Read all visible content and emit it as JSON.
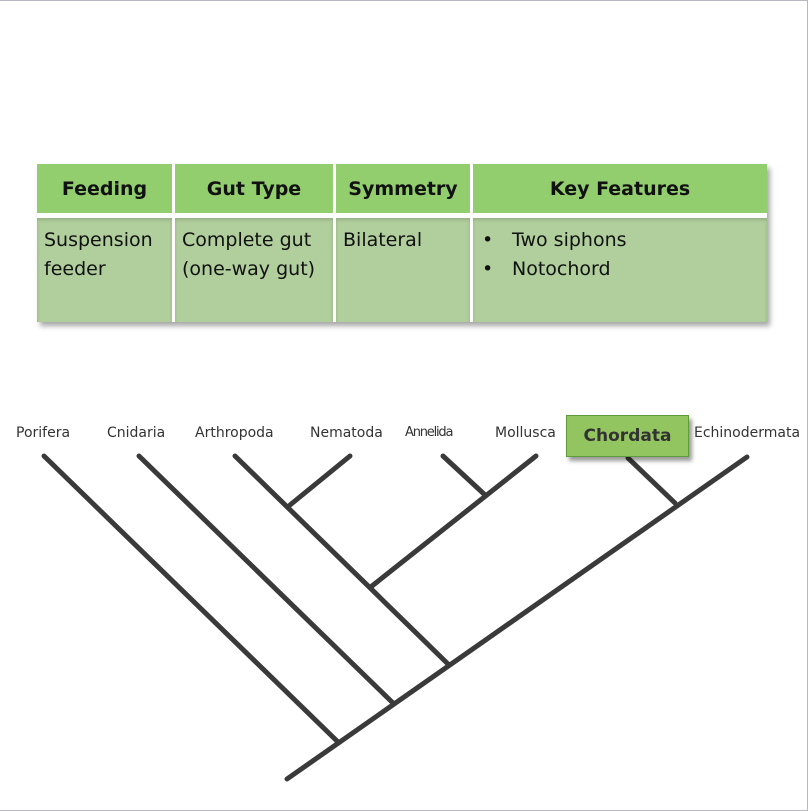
{
  "table": {
    "headers": [
      "Feeding",
      "Gut Type",
      "Symmetry",
      "Key Features"
    ],
    "row": {
      "feeding": [
        "Suspension",
        "feeder"
      ],
      "gut_type": [
        "Complete gut",
        "(one-way gut)"
      ],
      "symmetry": "Bilateral",
      "key_features": [
        "Two siphons",
        "Notochord"
      ]
    },
    "colors": {
      "header_bg": "#92cd6e",
      "body_bg": "#b0cf9c"
    }
  },
  "cladogram": {
    "taxa": [
      "Porifera",
      "Cnidaria",
      "Arthropoda",
      "Nematoda",
      "Annelida",
      "Mollusca",
      "Chordata",
      "Echinodermata"
    ],
    "highlighted_taxon": "Chordata",
    "highlight_color": "#92c560",
    "structure": "(Porifera,(Cnidaria,(((Arthropoda,Nematoda),(Annelida,Mollusca)),(Chordata,Echinodermata))))",
    "bullet_glyph": "•"
  }
}
